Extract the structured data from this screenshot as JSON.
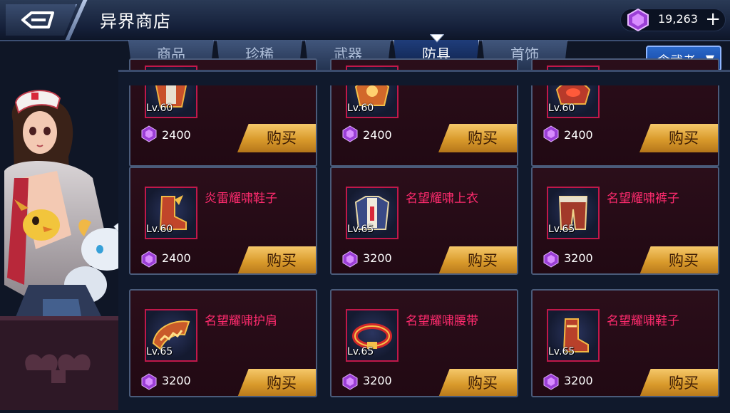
{
  "header": {
    "title": "异界商店",
    "currency_amount": "19,263",
    "plus_label": "+"
  },
  "tabs": [
    {
      "label": "商品",
      "active": false
    },
    {
      "label": "珍稀",
      "active": false
    },
    {
      "label": "武器",
      "active": false
    },
    {
      "label": "防具",
      "active": true
    },
    {
      "label": "首饰",
      "active": false
    }
  ],
  "class_select": {
    "value": "念武者",
    "caret": "▼"
  },
  "buy_label": "购买",
  "items": [
    {
      "name": "",
      "level": "Lv.60",
      "price": "2400",
      "icon": "armor-icon"
    },
    {
      "name": "",
      "level": "Lv.60",
      "price": "2400",
      "icon": "armor-icon"
    },
    {
      "name": "",
      "level": "Lv.60",
      "price": "2400",
      "icon": "armor-icon"
    },
    {
      "name": "炎雷耀啸鞋子",
      "level": "Lv.60",
      "price": "2400",
      "icon": "boots-icon"
    },
    {
      "name": "名望耀啸上衣",
      "level": "Lv.65",
      "price": "3200",
      "icon": "chest-armor-icon"
    },
    {
      "name": "名望耀啸裤子",
      "level": "Lv.65",
      "price": "3200",
      "icon": "pants-icon"
    },
    {
      "name": "名望耀啸护肩",
      "level": "Lv.65",
      "price": "3200",
      "icon": "shoulder-armor-icon"
    },
    {
      "name": "名望耀啸腰带",
      "level": "Lv.65",
      "price": "3200",
      "icon": "belt-icon"
    },
    {
      "name": "名望耀啸鞋子",
      "level": "Lv.65",
      "price": "3200",
      "icon": "boots-icon"
    }
  ],
  "colors": {
    "item_name": "#ff2b6e",
    "buy_button": "#e0a235",
    "active_tab": "#1f3d7a",
    "gem": "#b04fe0"
  }
}
